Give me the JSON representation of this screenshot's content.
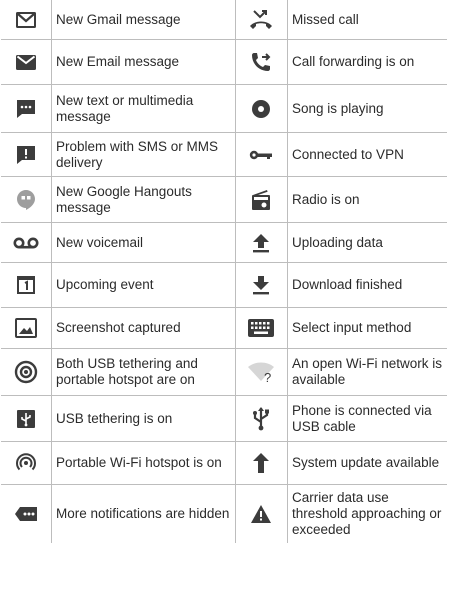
{
  "rows": [
    {
      "left": {
        "icon": "gmail-icon",
        "text": "New Gmail message"
      },
      "right": {
        "icon": "missed-call-icon",
        "text": "Missed call"
      }
    },
    {
      "left": {
        "icon": "email-icon",
        "text": "New Email message"
      },
      "right": {
        "icon": "call-forwarding-icon",
        "text": "Call forwarding is on"
      }
    },
    {
      "left": {
        "icon": "text-message-icon",
        "text": "New text or multimedia message"
      },
      "right": {
        "icon": "song-playing-icon",
        "text": "Song is playing"
      }
    },
    {
      "left": {
        "icon": "sms-problem-icon",
        "text": "Problem with SMS or MMS delivery"
      },
      "right": {
        "icon": "vpn-key-icon",
        "text": "Connected to VPN"
      }
    },
    {
      "left": {
        "icon": "hangouts-icon",
        "text": "New Google Hangouts message"
      },
      "right": {
        "icon": "radio-icon",
        "text": "Radio is on"
      }
    },
    {
      "left": {
        "icon": "voicemail-icon",
        "text": "New voicemail"
      },
      "right": {
        "icon": "upload-icon",
        "text": "Uploading data"
      }
    },
    {
      "left": {
        "icon": "calendar-event-icon",
        "text": "Upcoming event"
      },
      "right": {
        "icon": "download-icon",
        "text": "Download finished"
      }
    },
    {
      "left": {
        "icon": "screenshot-icon",
        "text": "Screenshot captured"
      },
      "right": {
        "icon": "keyboard-icon",
        "text": "Select input method"
      }
    },
    {
      "left": {
        "icon": "tethering-hotspot-icon",
        "text": "Both USB tethering and portable hotspot are on"
      },
      "right": {
        "icon": "open-wifi-icon",
        "text": "An open Wi-Fi network is available"
      }
    },
    {
      "left": {
        "icon": "usb-tethering-icon",
        "text": "USB tethering is on"
      },
      "right": {
        "icon": "usb-icon",
        "text": "Phone is connected via USB cable"
      }
    },
    {
      "left": {
        "icon": "wifi-hotspot-icon",
        "text": "Portable Wi-Fi hotspot is on"
      },
      "right": {
        "icon": "system-update-icon",
        "text": "System update available"
      }
    },
    {
      "left": {
        "icon": "more-notifications-icon",
        "text": "More notifications are hidden"
      },
      "right": {
        "icon": "warning-icon",
        "text": "Carrier data use threshold approaching or exceeded"
      }
    }
  ],
  "colors": {
    "icon_dark": "#3c3c3c",
    "icon_light": "#9e9e9e",
    "rule": "#bdbdbd"
  }
}
